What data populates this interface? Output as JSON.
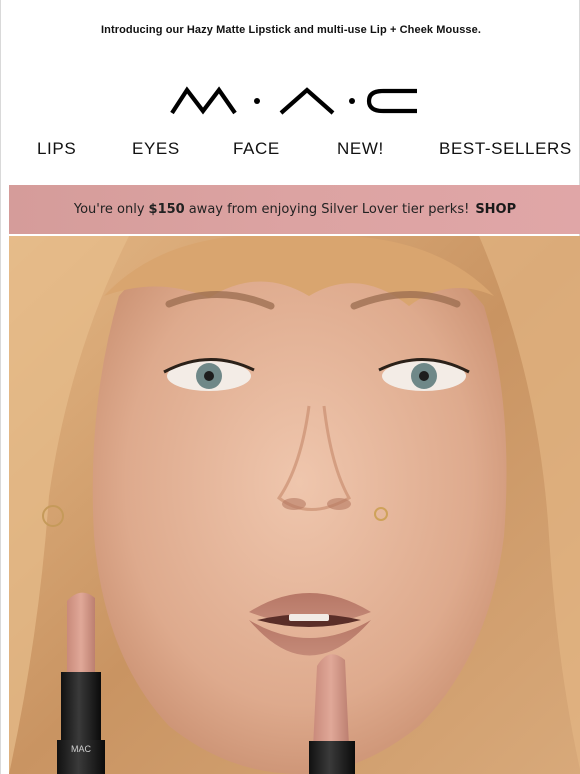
{
  "preheader": {
    "text": "Introducing our Hazy Matte Lipstick and multi-use Lip + Cheek Mousse."
  },
  "brand": {
    "logo_text": "MAC"
  },
  "nav": {
    "items": [
      {
        "label": "LIPS"
      },
      {
        "label": "EYES"
      },
      {
        "label": "FACE"
      },
      {
        "label": "NEW!"
      },
      {
        "label": "BEST-SELLERS"
      }
    ]
  },
  "banner": {
    "text_before": "You're only",
    "amount": "$150",
    "text_after": "away from enjoying Silver Lover tier perks!",
    "cta": "SHOP"
  },
  "hero": {
    "product_logo": "MAC",
    "image_description_icon": "hero-model-lipstick-image"
  },
  "colors": {
    "banner_pink": "#dca3a2",
    "text_dark": "#111111",
    "hair_blonde": "#d9a67c",
    "skin": "#e2b49a",
    "lipstick_nude": "#c98f7f"
  }
}
